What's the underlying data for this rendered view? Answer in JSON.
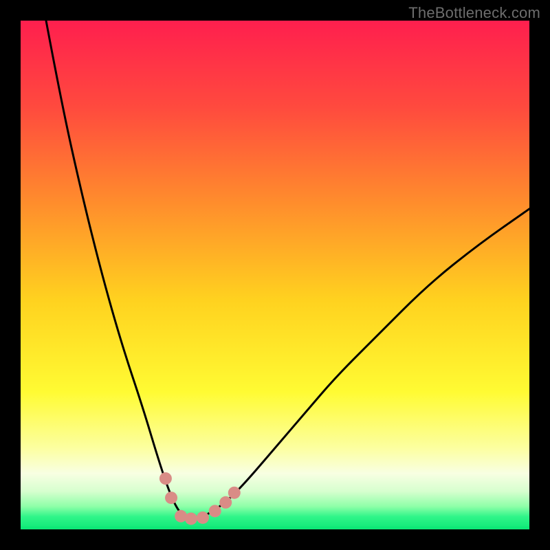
{
  "watermark": "TheBottleneck.com",
  "chart_data": {
    "type": "line",
    "title": "",
    "xlabel": "",
    "ylabel": "",
    "xlim": [
      0,
      100
    ],
    "ylim": [
      0,
      100
    ],
    "grid": false,
    "legend": false,
    "series": [
      {
        "name": "curve",
        "color": "#000000",
        "x": [
          5,
          8,
          12,
          16,
          20,
          24,
          27,
          29,
          30.5,
          32,
          33,
          34,
          36,
          40,
          44,
          50,
          56,
          62,
          70,
          80,
          90,
          100
        ],
        "y": [
          100,
          84,
          66,
          50,
          36,
          24,
          14,
          8,
          4.5,
          2.5,
          2,
          2,
          2.5,
          5,
          9,
          16,
          23,
          30,
          38,
          48,
          56,
          63
        ]
      }
    ],
    "markers": {
      "name": "curve-points",
      "color": "#d98c86",
      "radius_px": 9,
      "points": [
        {
          "x": 28.5,
          "y": 10
        },
        {
          "x": 29.6,
          "y": 6.2
        },
        {
          "x": 31.5,
          "y": 2.6
        },
        {
          "x": 33.5,
          "y": 2.1
        },
        {
          "x": 35.8,
          "y": 2.3
        },
        {
          "x": 38.2,
          "y": 3.6
        },
        {
          "x": 40.3,
          "y": 5.3
        },
        {
          "x": 42.0,
          "y": 7.2
        }
      ]
    },
    "background_gradient": {
      "stops": [
        {
          "offset": 0.0,
          "color": "#ff1f4e"
        },
        {
          "offset": 0.17,
          "color": "#ff4a3e"
        },
        {
          "offset": 0.35,
          "color": "#ff8a2d"
        },
        {
          "offset": 0.55,
          "color": "#ffd21f"
        },
        {
          "offset": 0.73,
          "color": "#fffb33"
        },
        {
          "offset": 0.84,
          "color": "#fcffa0"
        },
        {
          "offset": 0.89,
          "color": "#f8ffe2"
        },
        {
          "offset": 0.925,
          "color": "#d7ffcf"
        },
        {
          "offset": 0.955,
          "color": "#8effa8"
        },
        {
          "offset": 0.975,
          "color": "#30f589"
        },
        {
          "offset": 1.0,
          "color": "#0ee877"
        }
      ]
    },
    "baseline": {
      "color": "#0ee877",
      "y": 0,
      "thickness_px": 4
    }
  }
}
